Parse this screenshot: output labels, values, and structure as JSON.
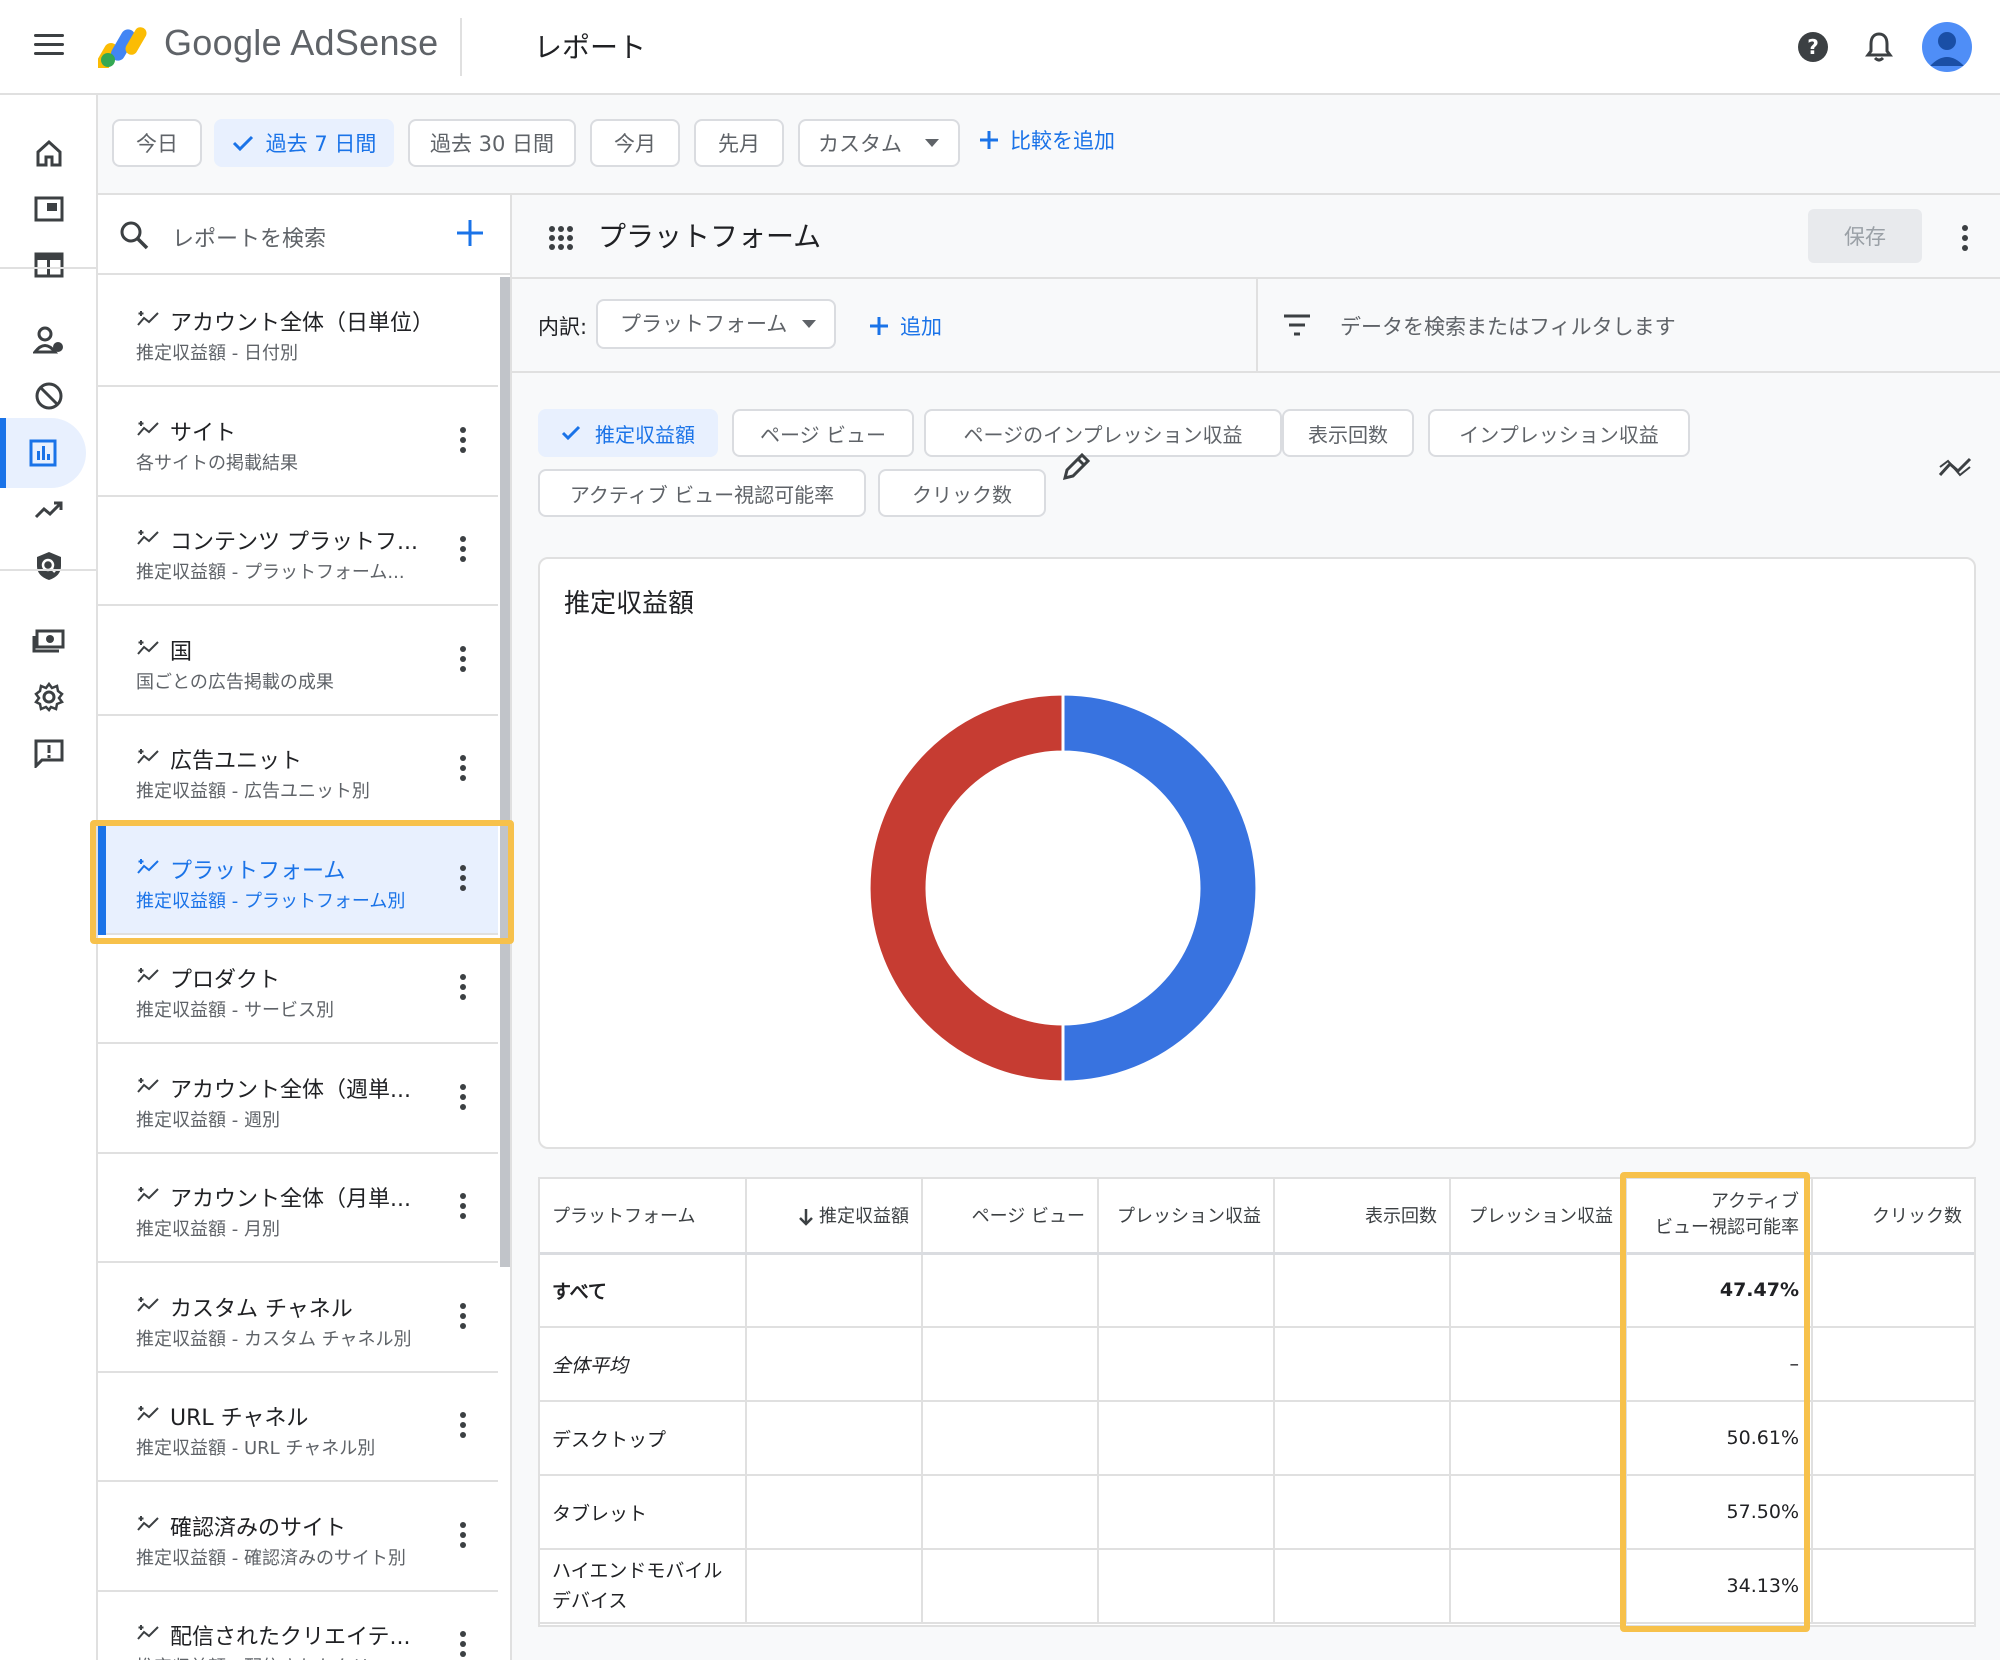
{
  "app": {
    "brand": "Google AdSense",
    "page_title": "レポート"
  },
  "colors": {
    "accent": "#1a73e8",
    "chart_blue": "#3873e0",
    "chart_red": "#c63c32",
    "highlight": "#f7c14b"
  },
  "icons": {
    "menu": "menu-icon",
    "help": "help-icon",
    "bell": "bell-icon",
    "avatar": "avatar-icon",
    "rail": [
      "home-icon",
      "ad-unit-icon",
      "layout-icon",
      "user-manage-icon",
      "block-icon",
      "report-icon",
      "trend-icon",
      "shield-search-icon",
      "payments-icon",
      "settings-icon",
      "feedback-icon"
    ]
  },
  "date_chips": [
    {
      "label": "今日",
      "selected": false
    },
    {
      "label": "過去 7 日間",
      "selected": true
    },
    {
      "label": "過去 30 日間",
      "selected": false
    },
    {
      "label": "今月",
      "selected": false
    },
    {
      "label": "先月",
      "selected": false
    },
    {
      "label": "カスタム",
      "selected": false
    }
  ],
  "add_compare_label": "比較を追加",
  "reports": {
    "search_placeholder": "レポートを検索",
    "items": [
      {
        "title": "アカウント全体（日単位）",
        "sub": "推定収益額 - 日付別",
        "active": false
      },
      {
        "title": "サイト",
        "sub": "各サイトの掲載結果",
        "active": false
      },
      {
        "title": "コンテンツ プラットフ...",
        "sub": "推定収益額 - プラットフォーム...",
        "active": false
      },
      {
        "title": "国",
        "sub": "国ごとの広告掲載の成果",
        "active": false
      },
      {
        "title": "広告ユニット",
        "sub": "推定収益額 - 広告ユニット別",
        "active": false
      },
      {
        "title": "プラットフォーム",
        "sub": "推定収益額 - プラットフォーム別",
        "active": true
      },
      {
        "title": "プロダクト",
        "sub": "推定収益額 - サービス別",
        "active": false
      },
      {
        "title": "アカウント全体（週単...",
        "sub": "推定収益額 - 週別",
        "active": false
      },
      {
        "title": "アカウント全体（月単...",
        "sub": "推定収益額 - 月別",
        "active": false
      },
      {
        "title": "カスタム チャネル",
        "sub": "推定収益額 - カスタム チャネル別",
        "active": false
      },
      {
        "title": "URL チャネル",
        "sub": "推定収益額 - URL チャネル別",
        "active": false
      },
      {
        "title": "確認済みのサイト",
        "sub": "推定収益額 - 確認済みのサイト別",
        "active": false
      },
      {
        "title": "配信されたクリエイテ...",
        "sub": "推定収益額 - 配信されたクリエ...",
        "active": false
      }
    ]
  },
  "main": {
    "title": "プラットフォーム",
    "save_label": "保存",
    "breakdown_label": "内訳:",
    "breakdown_value": "プラットフォーム",
    "add_label": "追加",
    "filter_placeholder": "データを検索またはフィルタします",
    "metrics": [
      {
        "label": "推定収益額",
        "selected": true
      },
      {
        "label": "ページ ビュー",
        "selected": false
      },
      {
        "label": "ページのインプレッション収益",
        "selected": false
      },
      {
        "label": "表示回数",
        "selected": false
      },
      {
        "label": "インプレッション収益",
        "selected": false
      },
      {
        "label": "アクティブ ビュー視認可能率",
        "selected": false
      },
      {
        "label": "クリック数",
        "selected": false
      }
    ],
    "chart_title": "推定収益額"
  },
  "chart_data": {
    "type": "pie",
    "title": "推定収益額",
    "slices": [
      {
        "value": 50,
        "color": "#3873e0"
      },
      {
        "value": 50,
        "color": "#c63c32"
      }
    ]
  },
  "table": {
    "headers": [
      "プラットフォーム",
      "推定収益額",
      "ページ ビュー",
      "プレッション収益",
      "表示回数",
      "プレッション収益",
      "アクティブ ビュー視認可能率",
      "クリック数"
    ],
    "header_active_line1": "アクティブ",
    "header_active_line2": "ビュー視認可能率",
    "rows": [
      {
        "name": "すべて",
        "viewability": "47.47%"
      },
      {
        "name": "全体平均",
        "viewability": "–"
      },
      {
        "name": "デスクトップ",
        "viewability": "50.61%"
      },
      {
        "name": "タブレット",
        "viewability": "57.50%"
      },
      {
        "name": "ハイエンドモバイル デバイス",
        "viewability": "34.13%"
      }
    ]
  }
}
